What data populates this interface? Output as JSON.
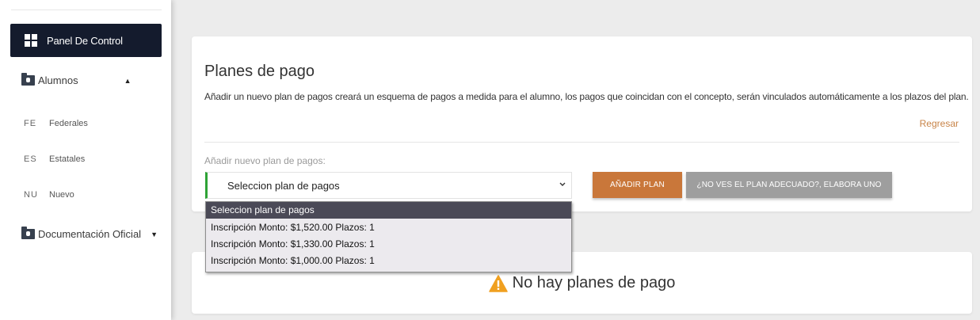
{
  "sidebar": {
    "active_item": "Panel De Control",
    "items": [
      {
        "label": "Alumnos",
        "caret": "▲"
      },
      {
        "label": "Documentación Oficial",
        "caret": "▼"
      }
    ],
    "subitems": [
      {
        "abbr": "FE",
        "label": "Federales"
      },
      {
        "abbr": "ES",
        "label": "Estatales"
      },
      {
        "abbr": "NU",
        "label": "Nuevo"
      }
    ]
  },
  "main": {
    "title": "Planes de pago",
    "description": "Añadir un nuevo plan de pagos creará un esquema de pagos a medida para el alumno, los pagos que coincidan con el concepto, serán vinculados automáticamente a los plazos del plan.",
    "back_link": "Regresar",
    "field_label": "Añadir nuevo plan de pagos:",
    "select_value": "Seleccion plan de pagos",
    "add_button": "AÑADIR PLAN",
    "alt_button": "¿NO VES EL PLAN ADECUADO?, ELABORA UNO",
    "empty_message": "No hay planes de pago"
  },
  "dropdown": {
    "options": [
      "Seleccion plan de pagos",
      "Inscripción Monto: $1,520.00 Plazos: 1",
      "Inscripción Monto: $1,330.00 Plazos: 1",
      "Inscripción Monto: $1,000.00 Plazos: 1"
    ],
    "selected_index": 0
  },
  "colors": {
    "sidebar_active": "#141b2d",
    "accent_orange": "#c9773a",
    "select_border_green": "#2ea336",
    "warning": "#f0a020"
  },
  "icons": {
    "dashboard": "dashboard-icon",
    "folder": "folder-account-icon",
    "warning": "warning-icon"
  }
}
